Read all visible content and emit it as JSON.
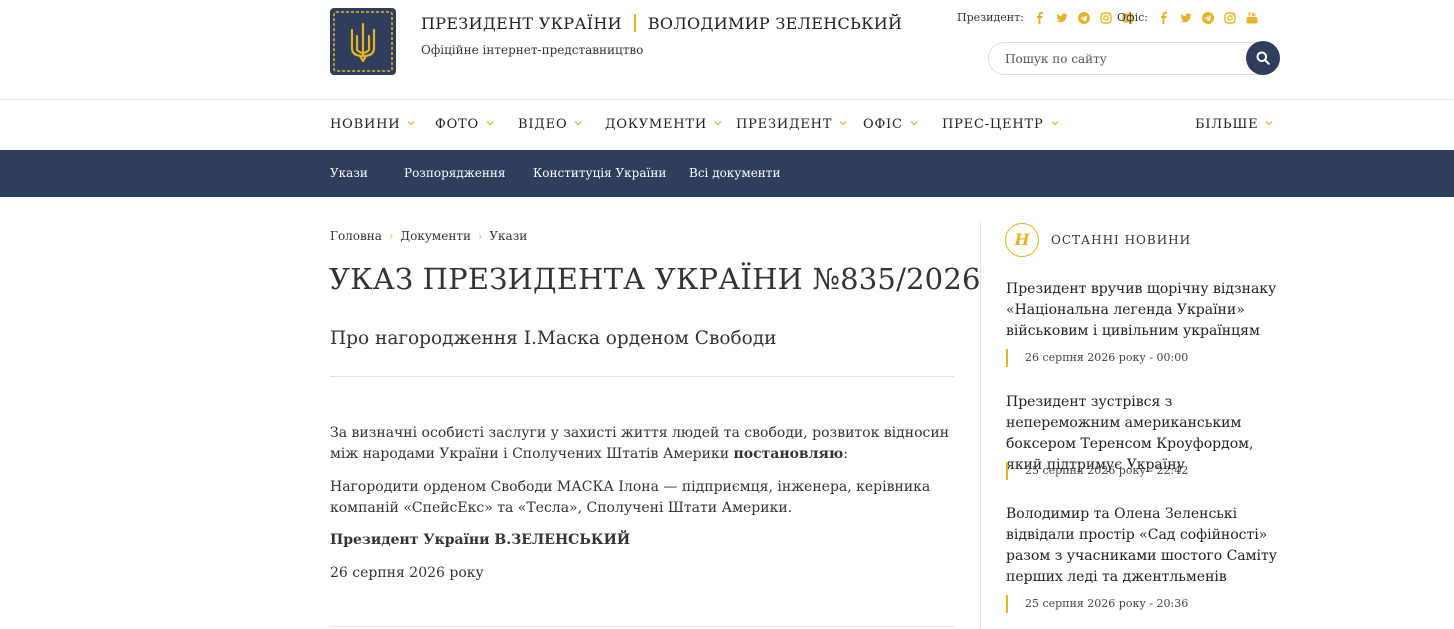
{
  "header": {
    "title_part1": "ПРЕЗИДЕНТ УКРАЇНИ",
    "title_part2": "ВОЛОДИМИР ЗЕЛЕНСЬКИЙ",
    "subtitle": "Офіційне інтернет-представництво",
    "logo_icon": "trident-icon",
    "social_president_label": "Президент:",
    "social_office_label": "Офіс:",
    "social_president_icons": [
      "facebook-icon",
      "twitter-icon",
      "telegram-icon",
      "instagram-icon",
      "flickr-icon"
    ],
    "social_office_icons": [
      "facebook-icon",
      "twitter-icon",
      "telegram-icon",
      "instagram-icon",
      "youtube-icon"
    ],
    "search_placeholder": "Пошук по сайту",
    "accent_color": "#e7b326",
    "brand_color": "#2f3e5c"
  },
  "mainnav": {
    "items": [
      {
        "label": "НОВИНИ"
      },
      {
        "label": "ФОТО"
      },
      {
        "label": "ВІДЕО"
      },
      {
        "label": "ДОКУМЕНТИ"
      },
      {
        "label": "ПРЕЗИДЕНТ"
      },
      {
        "label": "ОФІС"
      },
      {
        "label": "ПРЕС-ЦЕНТР"
      }
    ],
    "more": "БІЛЬШЕ"
  },
  "subnav": {
    "items": [
      {
        "label": "Укази"
      },
      {
        "label": "Розпорядження"
      },
      {
        "label": "Конституція України"
      },
      {
        "label": "Всі документи"
      }
    ]
  },
  "breadcrumb": [
    "Головна",
    "Документи",
    "Укази"
  ],
  "document": {
    "title": "УКАЗ ПРЕЗИДЕНТА УКРАЇНИ №835/2026",
    "subtitle": "Про нагородження І.Маска орденом Свободи",
    "preamble": "За визначні особисті заслуги у захисті життя людей та свободи, розвиток відносин між народами України і Сполучених Штатів Америки",
    "preamble_bold": "постановляю",
    "preamble_end": ":",
    "body": "Нагородити орденом Свободи МАСКА Ілона — підприємця, інженера, керівника компаній «СпейсЕкс» та «Тесла», Сполучені Штати Америки.",
    "signature": "Президент України В.ЗЕЛЕНСЬКИЙ",
    "date": "26 серпня 2026 року"
  },
  "sidebar": {
    "badge_letter": "Н",
    "heading": "ОСТАННІ НОВИНИ",
    "news": [
      {
        "title": "Президент вручив щорічну відзнаку «Національна легенда України» військовим і цивільним українцям",
        "date": "26 серпня 2026 року - 00:00"
      },
      {
        "title": "Президент зустрівся з непереможним американським боксером Теренсом Кроуфордом, який підтримує Україну",
        "date": "25 серпня 2026 року - 22:42"
      },
      {
        "title": "Володимир та Олена Зеленські відвідали простір «Сад софійності» разом з учасниками шостого Саміту перших леді та джентльменів",
        "date": "25 серпня 2026 року - 20:36"
      }
    ]
  }
}
